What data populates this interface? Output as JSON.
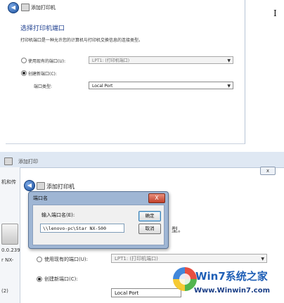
{
  "top": {
    "window_title": "添加打印机",
    "header": "选择打印机端口",
    "description": "打印机端口是一种允许您的计算机与打印机交换信息的连接类型。",
    "use_existing_label": "使用现有的端口(U):",
    "use_existing_value": "LPT1: (打印机端口)",
    "create_new_label": "创建新端口(C):",
    "port_type_label": "端口类型:",
    "port_type_value": "Local Port",
    "cursor_glyph": "I"
  },
  "bottom": {
    "window_title": "添加打印机",
    "tab_fragment": "添加打印",
    "close_glyph": "x",
    "left_strip": [
      "机和传",
      "0.0.239",
      "r NX-",
      "(2)"
    ],
    "dialog": {
      "title": "端口名",
      "close_glyph": "X",
      "prompt": "输入端口名(E):",
      "input_value": "\\\\lenovo-pc\\Star NX-500",
      "ok_label": "确定",
      "cancel_label": "取消"
    },
    "behind_text": "型。",
    "use_existing_label": "使用现有的端口(U):",
    "use_existing_value": "LPT1: (打印机端口)",
    "create_new_label": "创建新端口(C):",
    "port_type_value": "Local Port"
  },
  "watermark": {
    "brand": "Win7系统之家",
    "url": "Www.Winwin7.com"
  }
}
